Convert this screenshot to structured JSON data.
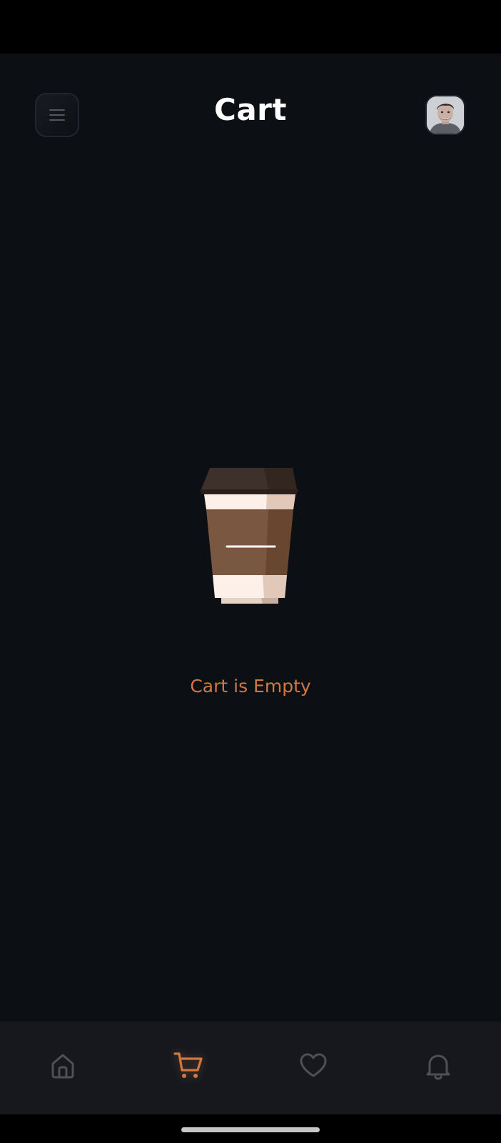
{
  "header": {
    "title": "Cart"
  },
  "empty_state": {
    "message": "Cart is Empty",
    "illustration": "coffee-cup"
  },
  "bottom_nav": {
    "items": [
      {
        "icon": "home-icon",
        "active": false
      },
      {
        "icon": "cart-icon",
        "active": true
      },
      {
        "icon": "heart-icon",
        "active": false
      },
      {
        "icon": "bell-icon",
        "active": false
      }
    ]
  },
  "colors": {
    "background": "#0C0F14",
    "accent": "#D17842",
    "nav_background": "#16181E",
    "inactive_icon": "#4E5053",
    "title": "#FFFFFF"
  }
}
